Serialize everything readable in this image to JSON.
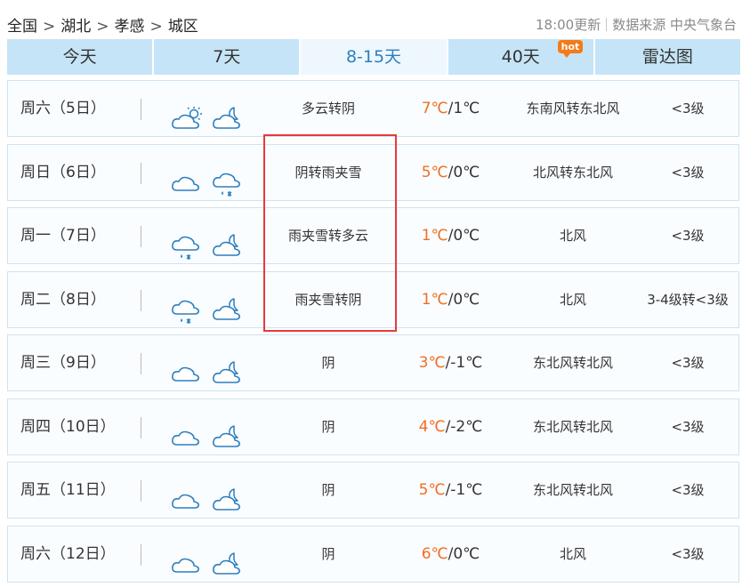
{
  "breadcrumb": {
    "items": [
      "全国",
      "湖北",
      "孝感",
      "城区"
    ],
    "separator": ">"
  },
  "update": {
    "time": "18:00更新",
    "source": "数据来源 中央气象台"
  },
  "tabs": [
    {
      "label": "今天",
      "active": false
    },
    {
      "label": "7天",
      "active": false
    },
    {
      "label": "8-15天",
      "active": true
    },
    {
      "label": "40天",
      "active": false,
      "badge": "hot"
    },
    {
      "label": "雷达图",
      "active": false
    }
  ],
  "forecast": [
    {
      "day": "周六（5日）",
      "icon_day": "partly-cloudy-day-icon",
      "icon_night": "partly-cloudy-night-icon",
      "desc": "多云转阴",
      "high": "7℃",
      "low": "/1℃",
      "wind": "东南风转东北风",
      "level": "<3级"
    },
    {
      "day": "周日（6日）",
      "icon_day": "cloudy-icon",
      "icon_night": "sleet-icon",
      "desc": "阴转雨夹雪",
      "high": "5℃",
      "low": "/0℃",
      "wind": "北风转东北风",
      "level": "<3级"
    },
    {
      "day": "周一（7日）",
      "icon_day": "sleet-icon",
      "icon_night": "partly-cloudy-night-icon",
      "desc": "雨夹雪转多云",
      "high": "1℃",
      "low": "/0℃",
      "wind": "北风",
      "level": "<3级"
    },
    {
      "day": "周二（8日）",
      "icon_day": "sleet-icon",
      "icon_night": "cloudy-night-icon",
      "desc": "雨夹雪转阴",
      "high": "1℃",
      "low": "/0℃",
      "wind": "北风",
      "level": "3-4级转<3级"
    },
    {
      "day": "周三（9日）",
      "icon_day": "cloudy-icon",
      "icon_night": "cloudy-night-icon",
      "desc": "阴",
      "high": "3℃",
      "low": "/-1℃",
      "wind": "东北风转北风",
      "level": "<3级"
    },
    {
      "day": "周四（10日）",
      "icon_day": "cloudy-icon",
      "icon_night": "cloudy-night-icon",
      "desc": "阴",
      "high": "4℃",
      "low": "/-2℃",
      "wind": "东北风转北风",
      "level": "<3级"
    },
    {
      "day": "周五（11日）",
      "icon_day": "cloudy-icon",
      "icon_night": "cloudy-night-icon",
      "desc": "阴",
      "high": "5℃",
      "low": "/-1℃",
      "wind": "东北风转北风",
      "level": "<3级"
    },
    {
      "day": "周六（12日）",
      "icon_day": "cloudy-icon",
      "icon_night": "cloudy-night-icon",
      "desc": "阴",
      "high": "6℃",
      "low": "/0℃",
      "wind": "北风",
      "level": "<3级"
    }
  ],
  "colors": {
    "tab_bg": "#c6e4f7",
    "tab_active_text": "#2b7fc3",
    "high_temp": "#f26d21",
    "highlight_box": "#e53b3b",
    "icon_stroke": "#2c7fbf"
  }
}
